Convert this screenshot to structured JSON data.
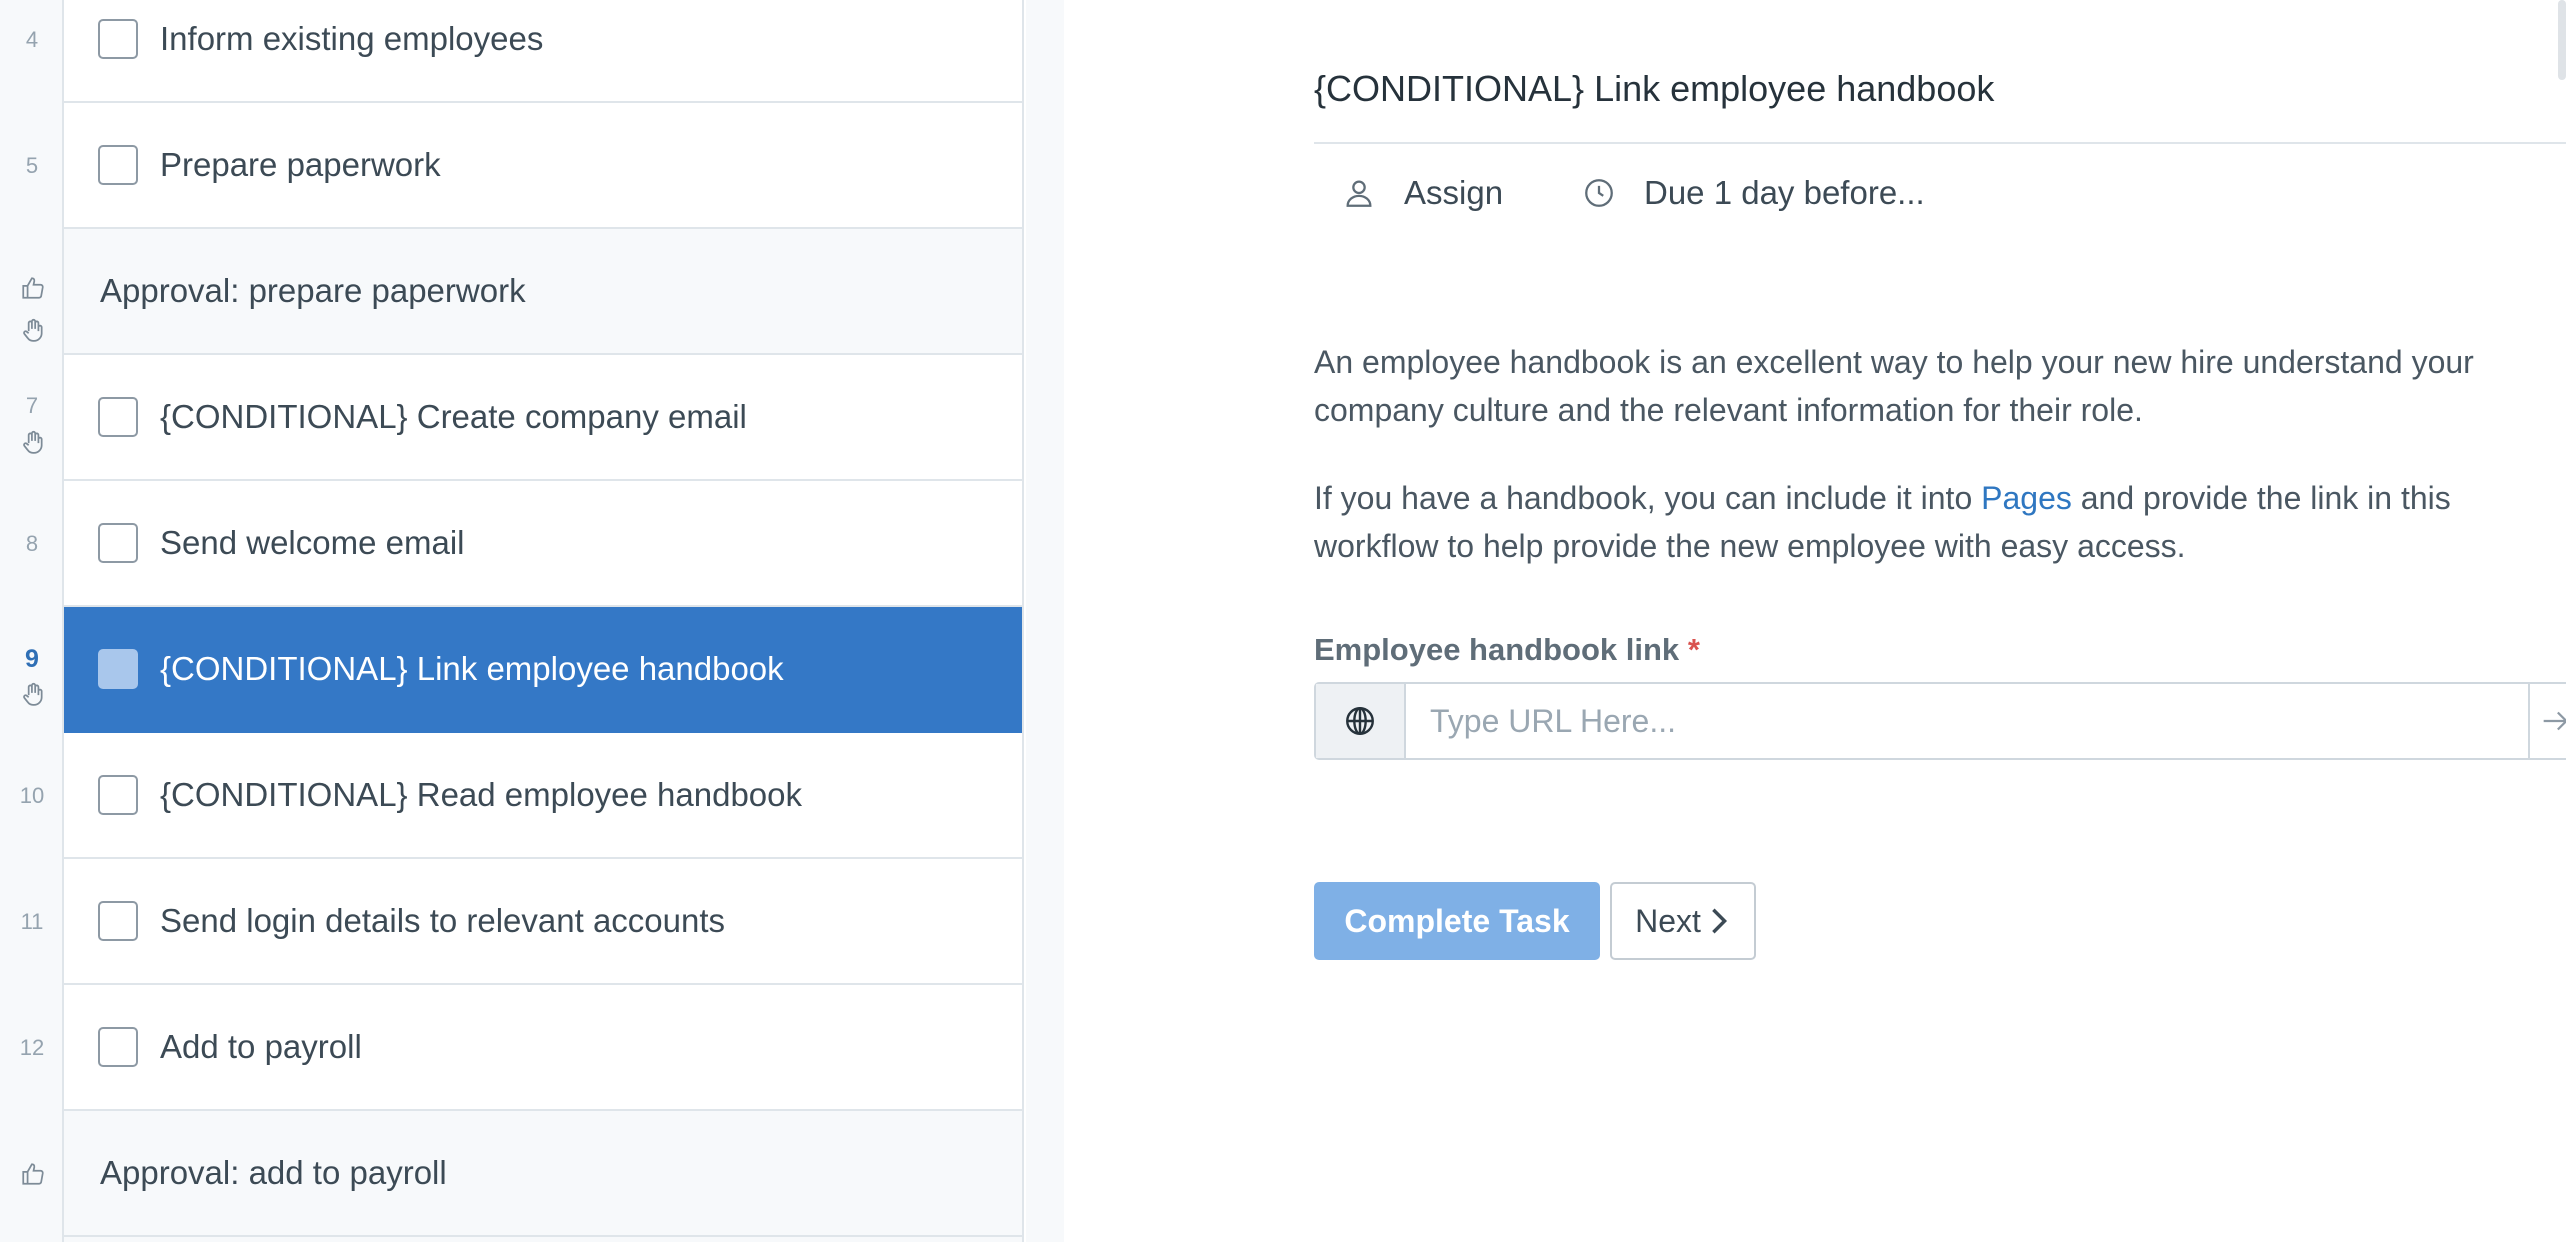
{
  "task_list": {
    "rows": [
      {
        "num": "4",
        "type": "task",
        "label": "Inform existing employees",
        "icons": []
      },
      {
        "num": "5",
        "type": "task",
        "label": "Prepare paperwork",
        "icons": []
      },
      {
        "num": "",
        "type": "approval",
        "label": "Approval: prepare paperwork",
        "icons": [
          "thumbs-up-icon",
          "hand-stop-icon"
        ]
      },
      {
        "num": "7",
        "type": "task",
        "label": "{CONDITIONAL} Create company email",
        "icons": [
          "hand-stop-icon"
        ]
      },
      {
        "num": "8",
        "type": "task",
        "label": "Send welcome email",
        "icons": []
      },
      {
        "num": "9",
        "type": "task",
        "label": "{CONDITIONAL} Link employee handbook",
        "icons": [
          "hand-stop-icon"
        ],
        "selected": true
      },
      {
        "num": "10",
        "type": "task",
        "label": "{CONDITIONAL} Read employee handbook",
        "icons": []
      },
      {
        "num": "11",
        "type": "task",
        "label": "Send login details to relevant accounts",
        "icons": []
      },
      {
        "num": "12",
        "type": "task",
        "label": "Add to payroll",
        "icons": []
      },
      {
        "num": "",
        "type": "approval",
        "label": "Approval: add to payroll",
        "icons": [
          "thumbs-up-icon"
        ]
      }
    ]
  },
  "task_detail": {
    "title": "{CONDITIONAL} Link employee handbook",
    "assign_label": "Assign",
    "due_label": "Due 1 day before...",
    "description_p1": "An employee handbook is an excellent way to help your new hire understand your company culture and the relevant information for their role.",
    "description_p2_before": "If you have a handbook, you can include it into ",
    "description_p2_link": "Pages",
    "description_p2_after": " and provide the link in this workflow to help provide the new employee with easy access.",
    "field_label": "Employee handbook link",
    "field_required_mark": "*",
    "url_placeholder": "Type URL Here...",
    "url_value": "",
    "complete_label": "Complete Task",
    "next_label": "Next"
  },
  "colors": {
    "selected_row": "#3478c6",
    "complete_button": "#7fb0e6",
    "link": "#2f77c1",
    "required": "#d9534f"
  }
}
